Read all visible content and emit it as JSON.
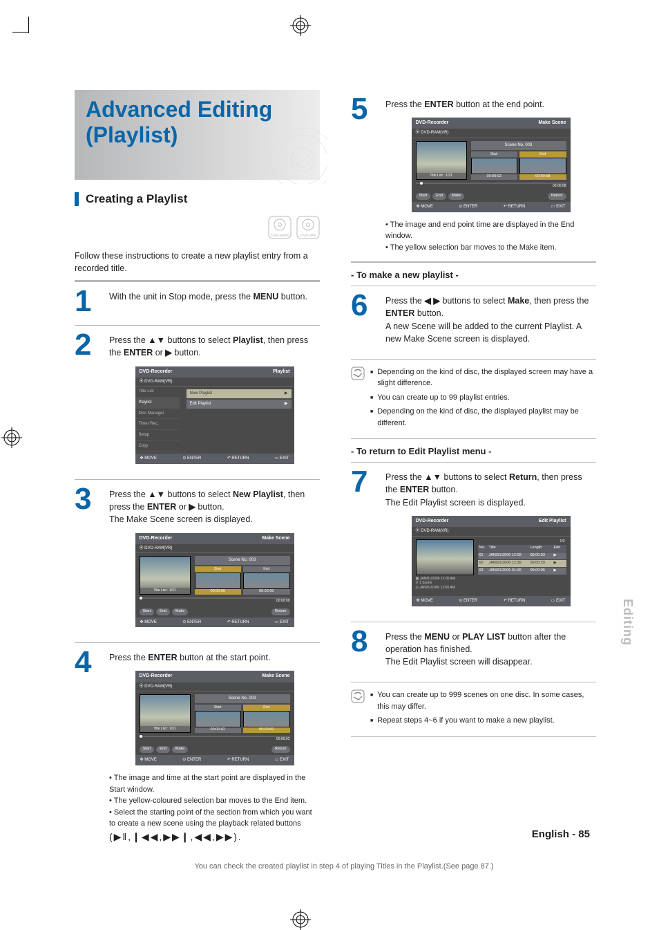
{
  "side_tab": "Editing",
  "page_number": "- 85",
  "related_hint": "You can check the created playlist in step 4 of playing Titles in the Playlist.(See page 87.)",
  "transport_glyphs": "(▶‖,❙◀◀,▶▶❙,◀◀,▶▶)",
  "left_col": {
    "title_line1": "Advanced Editing",
    "title_line2": "(Playlist)",
    "section": "Creating a Playlist",
    "badges": [
      "DVD-RAM",
      "DVD-RW"
    ],
    "intro": "Follow these instructions to create a new playlist entry from a recorded title.",
    "step1": {
      "num": "1",
      "text_a": "With the unit in Stop mode, press the ",
      "b1": "MENU",
      "text_b": " button."
    },
    "step2": {
      "num": "2",
      "text_a": "Press the ",
      "arr": "▲▼",
      "text_b": " buttons to select ",
      "b1": "Playlist",
      "text_c": ", then press the ",
      "b2": "ENTER",
      "text_d": " or ",
      "arr2": "▶",
      "text_e": " button."
    },
    "step3": {
      "num": "3",
      "text_a": "Press the ",
      "arr": "▲▼",
      "text_b": " buttons to select ",
      "b1": "New Playlist",
      "text_c": ", then press the ",
      "b2": "ENTER",
      "text_d": " or ",
      "arr2": "▶",
      "text_e": " button.",
      "after": "The Make Scene screen is displayed."
    },
    "step4": {
      "num": "4",
      "text_a": "Press the ",
      "b1": "ENTER",
      "text_b": " button at the start point.",
      "bullets": [
        "The image and time at the start point are displayed in the Start window.",
        "The yellow-coloured selection bar moves to the End item.",
        "Select the starting point of the section from which you want to create a new scene using the playback related buttons"
      ]
    },
    "osd_menu": {
      "hdr_left": "DVD-Recorder",
      "hdr_right": "Playlist",
      "sub": "DVD-RAM(VR)",
      "sidebar": [
        "Title List",
        "Playlist",
        "Disc Manager",
        "Timer Rec.",
        "Setup",
        "Copy"
      ],
      "entries": [
        "New  Playlist",
        "Edit Playlist"
      ],
      "chev": "▶",
      "ftr": [
        "MOVE",
        "ENTER",
        "RETURN",
        "EXIT"
      ]
    },
    "osd_scene3": {
      "hdr_left": "DVD-Recorder",
      "hdr_right": "Make Scene",
      "sub": "DVD-RAM(VR)",
      "thumb_label": "Title List : 1/31",
      "scene": "Scene No. 003",
      "start": "Start",
      "end": "End",
      "t_start": "00:00:00",
      "t_end": "00:00:00",
      "prog": "00:00:00",
      "btns": [
        "Start",
        "End",
        "Make"
      ],
      "ret": "Return",
      "ftr": [
        "MOVE",
        "ENTER",
        "RETURN",
        "EXIT"
      ]
    },
    "osd_scene4": {
      "hdr_left": "DVD-Recorder",
      "hdr_right": "Make Scene",
      "sub": "DVD-RAM(VR)",
      "thumb_label": "Title List : 1/31",
      "scene": "Scene No. 003",
      "start": "Start",
      "end": "End",
      "t_start": "00:00:02",
      "t_end": "00:00:00",
      "prog": "00:00:02",
      "btns": [
        "Start",
        "End",
        "Make"
      ],
      "ret": "Return",
      "ftr": [
        "MOVE",
        "ENTER",
        "RETURN",
        "EXIT"
      ]
    }
  },
  "right_col": {
    "step5": {
      "num": "5",
      "text_a": "Press the ",
      "b1": "ENTER",
      "text_b": " button at the end point.",
      "bullets": [
        "The image and end point time are displayed in the End window.",
        "The yellow selection bar moves to the Make item."
      ]
    },
    "osd_scene5": {
      "hdr_left": "DVD-Recorder",
      "hdr_right": "Make Scene",
      "sub": "DVD-RAM(VR)",
      "thumb_label": "Title List : 1/31",
      "scene": "Scene No. 003",
      "start": "Start",
      "end": "End",
      "t_start": "00:00:02",
      "t_end": "00:00:08",
      "prog": "00:00:08",
      "btns": [
        "Start",
        "End",
        "Make"
      ],
      "ret": "Return",
      "ftr": [
        "MOVE",
        "ENTER",
        "RETURN",
        "EXIT"
      ]
    },
    "heading_make": "- To make a new playlist -",
    "step6": {
      "num": "6",
      "text_a": "Press the ",
      "arr": "◀ ▶",
      "text_b": " buttons to select ",
      "b1": "Make",
      "text_c": ", then press the ",
      "b2": "ENTER",
      "text_d": " button.",
      "after": "A new Scene will be added to the current Playlist. A new Make Scene screen is displayed."
    },
    "notes1": [
      "Depending on the kind of disc, the displayed screen may have a slight difference.",
      "You can create up to 99 playlist entries.",
      "Depending on the kind of disc, the displayed playlist may be different."
    ],
    "heading_edit": "- To return to Edit Playlist menu -",
    "step7": {
      "num": "7",
      "text_a": "Press the ",
      "arr": "▲▼",
      "text_b": " buttons to select ",
      "b1": "Return",
      "text_c": ", then press the ",
      "b2": "ENTER",
      "text_d": " button.",
      "after": "The Edit Playlist screen is displayed."
    },
    "osd_edit": {
      "hdr_left": "DVD-Recorder",
      "hdr_right": "Edit Playlist",
      "sub": "DVD-RAM(VR)",
      "pag": "1/3",
      "meta": [
        "JAN/01/2006 12:00 AM",
        "1 Scene",
        "JAN/01/2006 12:00 AM"
      ],
      "cols": [
        "No.",
        "Title",
        "Length",
        "Edit"
      ],
      "rows": [
        [
          "01",
          "JAN/01/2006 12:00",
          "00:00:03",
          "▶"
        ],
        [
          "02",
          "JAN/01/2006 12:30",
          "00:00:20",
          "▶"
        ],
        [
          "03",
          "JAN/01/2006 01:00",
          "00:00:05",
          "▶"
        ]
      ],
      "ftr": [
        "MOVE",
        "ENTER",
        "RETURN",
        "EXIT"
      ]
    },
    "step8": {
      "num": "8",
      "text_a": "Press the ",
      "b1": "MENU",
      "text_b": " or ",
      "b2": "PLAY LIST",
      "text_c": " button after the operation has finished.",
      "after": "The Edit Playlist screen will disappear."
    },
    "notes2": [
      "You can create up to 999 scenes on one disc. In some cases, this may differ.",
      "Repeat steps 4~6 if you want to make a new playlist."
    ]
  }
}
